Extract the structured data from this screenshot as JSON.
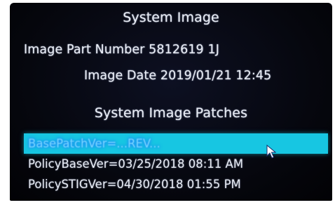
{
  "screen": {
    "title": "System Image",
    "part_number_label": "Image Part Number",
    "part_number_value": "5812619 1J",
    "date_label": "Image Date",
    "date_value": "2019/01/21 12:45",
    "patches_title": "System Image Patches",
    "patches": [
      {
        "text": "BasePatchVer=...REV..."
      },
      {
        "text": "PolicyBaseVer=03/25/2018 08:11 AM"
      },
      {
        "text": "PolicySTIGVer=04/30/2018 01:55 PM"
      }
    ]
  },
  "colors": {
    "background": "#05060c",
    "text": "#e8ecf4",
    "selection": "#17c6e2",
    "selected_text": "#7ad7ff"
  },
  "icons": {
    "pointer": "mouse-pointer-icon"
  }
}
